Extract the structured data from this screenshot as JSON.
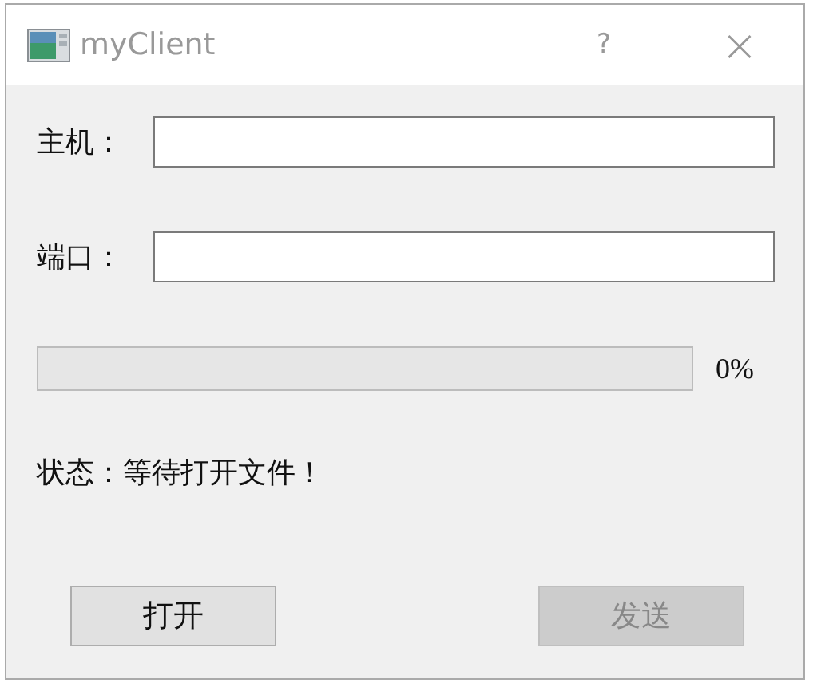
{
  "window": {
    "title": "myClient",
    "help": "?",
    "close": "×"
  },
  "fields": [
    {
      "label": "主机："
    },
    {
      "label": "端口："
    }
  ],
  "progress": {
    "level": 0,
    "reading": "0%"
  },
  "status": "状态：等待打开文件！",
  "buttons": [
    {
      "label": "打开",
      "disabled": false
    },
    {
      "label": "发送",
      "disabled": true
    }
  ]
}
